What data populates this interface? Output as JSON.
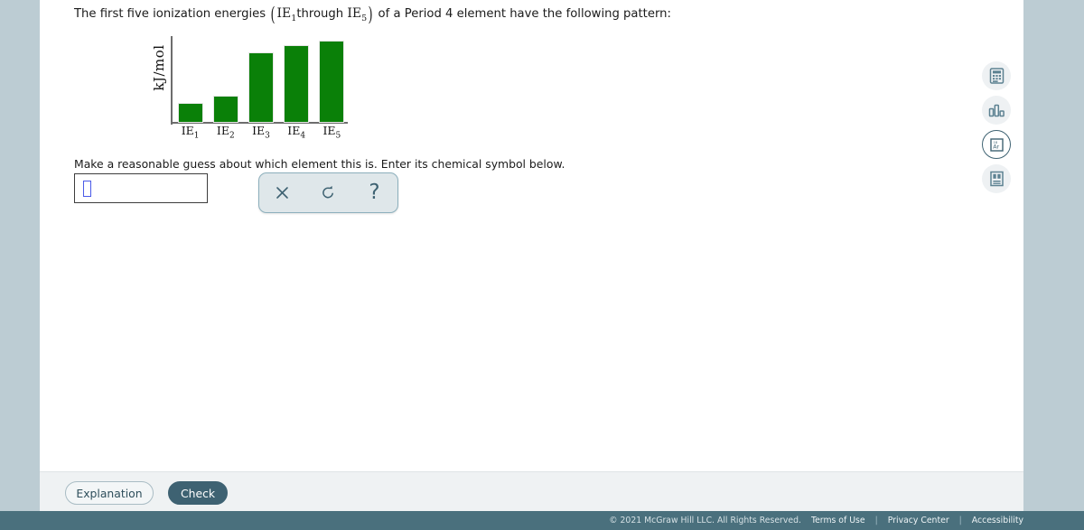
{
  "question": {
    "lead": "The first five ionization energies",
    "paren_open": "(",
    "ie_first": "IE",
    "ie_first_sub": "1",
    "through": "through",
    "ie_last": "IE",
    "ie_last_sub": "5",
    "paren_close": ")",
    "tail": "of a Period 4 element have the following pattern:",
    "instruction": "Make a reasonable guess about which element this is. Enter its chemical symbol below."
  },
  "chart_data": {
    "type": "bar",
    "title": "",
    "xlabel": "",
    "ylabel": "kJ/mol",
    "categories": [
      "IE1",
      "IE2",
      "IE3",
      "IE4",
      "IE5"
    ],
    "tick_labels": [
      {
        "base": "IE",
        "sub": "1"
      },
      {
        "base": "IE",
        "sub": "2"
      },
      {
        "base": "IE",
        "sub": "3"
      },
      {
        "base": "IE",
        "sub": "4"
      },
      {
        "base": "IE",
        "sub": "5"
      }
    ],
    "values": [
      22,
      30,
      78,
      86,
      91
    ],
    "ylim": [
      0,
      100
    ],
    "bar_color": "#0a8008",
    "grid": false,
    "legend": false,
    "axis_color": "#6d6d6d"
  },
  "answer": {
    "value": "",
    "placeholder": "",
    "caret_color": "#4a5ae8"
  },
  "mini_toolbar": {
    "clear_label": "clear-icon",
    "undo_label": "undo-icon",
    "help_label": "?"
  },
  "rail": {
    "items": [
      {
        "name": "calculator",
        "label": "calculator-icon",
        "active": false
      },
      {
        "name": "bar-chart",
        "label": "bar-chart-icon",
        "active": false
      },
      {
        "name": "periodic-table",
        "label": "Ar",
        "sup": "18",
        "active": true
      },
      {
        "name": "reference-book",
        "label": "reference-icon",
        "active": false
      }
    ]
  },
  "actions": {
    "explanation_label": "Explanation",
    "check_label": "Check"
  },
  "footer": {
    "copyright": "© 2021 McGraw Hill LLC. All Rights Reserved.",
    "links": [
      "Terms of Use",
      "Privacy Center",
      "Accessibility"
    ],
    "separator": "|"
  },
  "colors": {
    "page_bg": "#bcccd3",
    "card_bg": "#ffffff",
    "brand": "#4a707d",
    "accent": "#3e6272",
    "bar_green": "#0a8008"
  }
}
